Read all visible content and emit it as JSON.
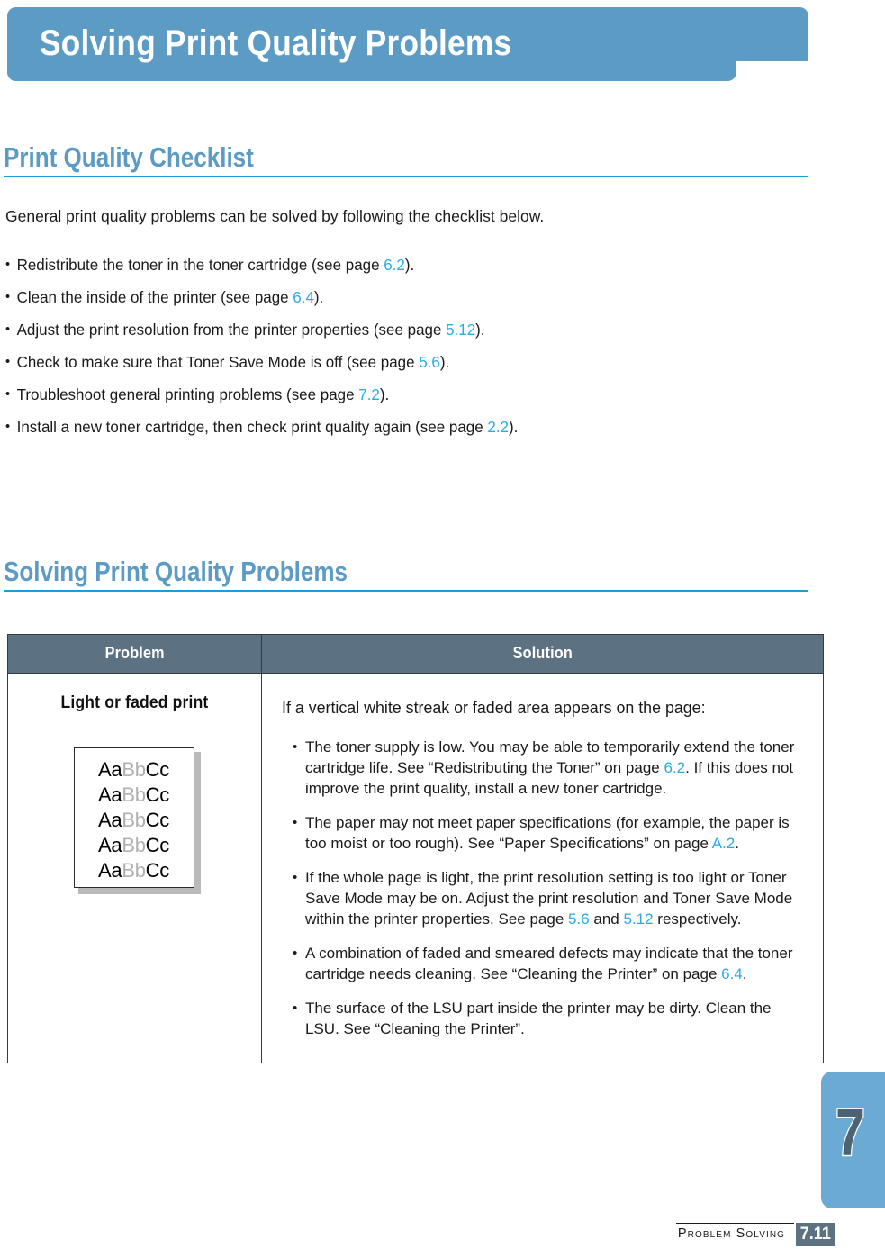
{
  "chapter": {
    "banner_title": "Solving Print Quality Problems",
    "tab_number": "7",
    "banner_color": "#5b9bc4",
    "tab_color": "#6aaad3"
  },
  "sections": {
    "checklist": {
      "heading": "Print Quality Checklist",
      "intro": "General print quality problems can be solved by following the checklist below.",
      "bullet_marker": "•",
      "items": [
        {
          "before": "Redistribute the toner in the toner cartridge (see page ",
          "page_ref": "6.2",
          "after": ")."
        },
        {
          "before": "Clean the inside of the printer (see page ",
          "page_ref": "6.4",
          "after": ")."
        },
        {
          "before": "Adjust the print resolution from the printer properties (see page ",
          "page_ref": "5.12",
          "after": ")."
        },
        {
          "before": "Check to make sure that Toner Save Mode is off (see page ",
          "page_ref": "5.6",
          "after": ")."
        },
        {
          "before": "Troubleshoot general printing problems (see page ",
          "page_ref": "7.2",
          "after": ")."
        },
        {
          "before": "Install a new toner cartridge, then check print quality again (see page ",
          "page_ref": "2.2",
          "after": ")."
        }
      ]
    },
    "solving": {
      "heading": "Solving Print Quality Problems"
    }
  },
  "table": {
    "headers": {
      "problem": "Problem",
      "solution": "Solution"
    },
    "header_bg": "#5c7182",
    "row": {
      "problem_label": "Light or faded print",
      "sample": {
        "lines": [
          {
            "dark1": "Aa",
            "faded": "Bb",
            "dark2": "Cc"
          },
          {
            "dark1": "Aa",
            "faded": "Bb",
            "dark2": "Cc"
          },
          {
            "dark1": "Aa",
            "faded": "Bb",
            "dark2": "Cc"
          },
          {
            "dark1": "Aa",
            "faded": "Bb",
            "dark2": "Cc"
          },
          {
            "dark1": "Aa",
            "faded": "Bb",
            "dark2": "Cc"
          }
        ]
      },
      "solution_lead": "If a vertical white streak or faded area appears on the page:",
      "bullet_marker": "•",
      "solution_items": [
        {
          "part1": "The toner supply is low. You may be able to temporarily extend the toner cartridge life. See “Redistributing the Toner” on page ",
          "page_ref": "6.2",
          "part2": ". If this does not improve the print quality, install a new toner cartridge."
        },
        {
          "part1": "The paper may not meet paper specifications (for example, the paper is too moist or too rough). See “Paper Specifications” on page ",
          "page_ref": "A.2",
          "part2": "."
        },
        {
          "part1": "If the whole page is light, the print resolution setting is too light or Toner Save Mode may be on. Adjust the print resolution and Toner Save Mode within the printer properties. See page ",
          "page_ref": "5.6",
          "part2": " and ",
          "page_ref2": "5.12",
          "part3": " respectively."
        },
        {
          "part1": "A combination of faded and smeared defects may indicate that the toner cartridge needs cleaning. See “Cleaning the Printer” on page ",
          "page_ref": "6.4",
          "part2": "."
        },
        {
          "part1": "The surface of the LSU part inside the printer may be dirty. Clean the LSU. See “Cleaning the Printer”.",
          "page_ref": "",
          "part2": ""
        }
      ]
    }
  },
  "footer": {
    "label": "Problem Solving",
    "page_number": "7.11",
    "page_number_bg": "#5c7182"
  }
}
